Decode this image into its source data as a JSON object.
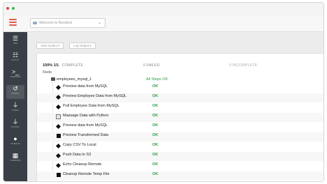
{
  "window": {
    "controls": [
      "close",
      "maximize"
    ],
    "accent_red": "#e0443e",
    "accent_green": "#2dbf4f"
  },
  "topbar": {
    "menu_icon": "hamburger-icon",
    "project_select_value": "Welcome to Rundeck"
  },
  "sidebar": {
    "items": [
      {
        "icon": "list-icon",
        "label": "JOBS"
      },
      {
        "icon": "activity-icon",
        "label": "ACTIVITY"
      },
      {
        "icon": "terminal-icon",
        "label": "COMMANDS"
      },
      {
        "icon": "history-icon",
        "label": "HISTORY"
      },
      {
        "icon": "plug-icon",
        "label": "NODES"
      },
      {
        "icon": "plugin-icon",
        "label": "PLUGINS"
      },
      {
        "icon": "clock-icon",
        "label": "SCHEDULE"
      },
      {
        "icon": "calendar-icon",
        "label": "CALENDARS"
      }
    ]
  },
  "toolbar": {
    "view_nodes_label": "View Nodes ▾",
    "log_output_label": "Log Output ▾"
  },
  "summary": {
    "progress": "100% 1/1",
    "complete_label": "COMPLETE",
    "failed": "0 FAILED",
    "incomplete": "0 INCOMPLETE"
  },
  "table": {
    "node_header": "Node",
    "job_name": "employees_mysql_1",
    "job_status": "All Steps OK"
  },
  "steps": [
    {
      "name": "Preview data from MySQL",
      "status": "OK",
      "icon": "diamond"
    },
    {
      "name": "Preview Employee Data from MySQL",
      "status": "OK",
      "icon": "diamond"
    },
    {
      "name": "Pull Employee Data from MySQL",
      "status": "OK",
      "icon": "diamond"
    },
    {
      "name": "Massage Data with Python",
      "status": "OK",
      "icon": "python"
    },
    {
      "name": "Preview data from MySQL",
      "status": "OK",
      "icon": "diamond"
    },
    {
      "name": "Preview Transformed Data",
      "status": "OK",
      "icon": "square"
    },
    {
      "name": "Copy CSV To Local",
      "status": "OK",
      "icon": "diamond"
    },
    {
      "name": "Push Data to S3",
      "status": "OK",
      "icon": "diamond"
    },
    {
      "name": "Echo Cleanup Remote",
      "status": "OK",
      "icon": "diamond"
    },
    {
      "name": "Cleanup Remote Temp File",
      "status": "OK",
      "icon": "square"
    }
  ],
  "colors": {
    "sidebar_bg": "#3a3f47",
    "ok_green": "#2e9e41",
    "brand_red": "#e25b4a"
  }
}
